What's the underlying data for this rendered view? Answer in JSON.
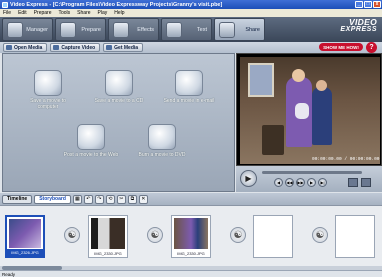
{
  "window": {
    "title": "Video Express - [C:\\Program Files\\Video Expressway Projects\\Granny's visit.pbe]",
    "minimize": "_",
    "maximize": "□",
    "close": "x"
  },
  "menu": [
    "File",
    "Edit",
    "Prepare",
    "Tools",
    "Share",
    "Play",
    "Help"
  ],
  "steps": [
    {
      "label": "Manager"
    },
    {
      "label": "Prepare"
    },
    {
      "label": "Effects"
    },
    {
      "label": "Text"
    },
    {
      "label": "Share"
    }
  ],
  "logo": {
    "line1": "VIDEO",
    "line2": "EXPRESS"
  },
  "tasks": [
    {
      "label": "Open Media"
    },
    {
      "label": "Capture Video"
    },
    {
      "label": "Get Media"
    }
  ],
  "show_me_how": "SHOW ME HOW!",
  "help": "?",
  "share_options": [
    {
      "label": "Save a movie to computer"
    },
    {
      "label": "Save a movie to a CD"
    },
    {
      "label": "Send a movie in e-mail"
    },
    {
      "label": "Post a movie to the Web"
    },
    {
      "label": "Burn a movie to DVD"
    }
  ],
  "preview": {
    "timecode": "00:00:00.00 / 00:00:00.00"
  },
  "controls": {
    "play": "▶",
    "prev_frame": "◀",
    "prev": "◀◀",
    "next": "▶▶",
    "next_frame": "▶",
    "end": "▶|"
  },
  "timeline_tabs": {
    "timeline": "Timeline",
    "storyboard": "Storyboard"
  },
  "toolbar": {
    "b1": "▦",
    "b2": "↶",
    "b3": "↷",
    "b4": "⟲",
    "b5": "✂",
    "b6": "⧉",
    "b7": "✕"
  },
  "clips": [
    {
      "caption": "IMG_2326.JPG"
    },
    {
      "caption": "IMG_2330.JPG"
    },
    {
      "caption": "IMG_2330.JPG"
    },
    {
      "caption": ""
    },
    {
      "caption": ""
    }
  ],
  "status": "Ready"
}
